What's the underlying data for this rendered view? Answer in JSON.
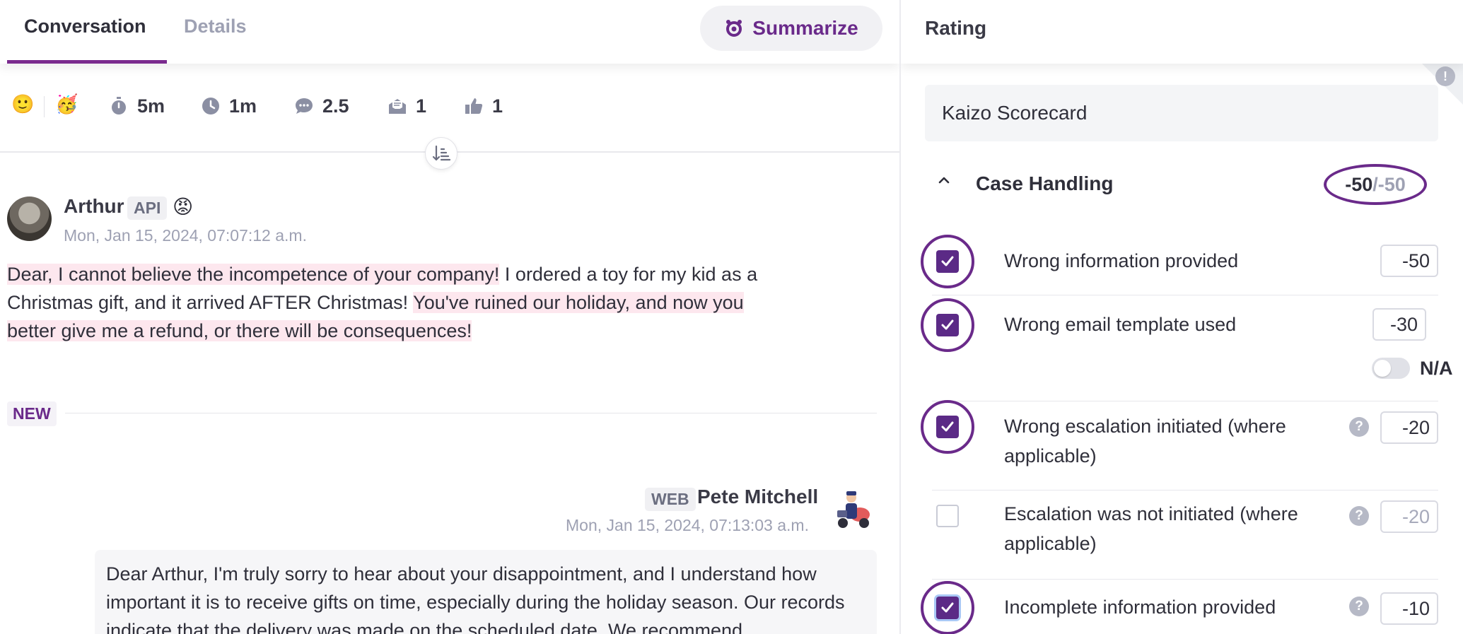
{
  "tabs": [
    {
      "label": "Conversation",
      "active": true
    },
    {
      "label": "Details",
      "active": false
    }
  ],
  "summarize": {
    "label": "Summarize"
  },
  "stats": {
    "emoji_face": "🙂",
    "emoji_party": "🥳",
    "handle_time": "5m",
    "response_time": "1m",
    "messages": "2.5",
    "emails": "1",
    "likes": "1"
  },
  "messages": [
    {
      "author": "Arthur",
      "channel": "API",
      "emoji": "😡",
      "timestamp": "Mon, Jan 15, 2024, 07:07:12 a.m.",
      "text_parts": [
        "Dear, I cannot believe the incompetence of your company!",
        " I ordered a toy for my kid as a Christmas gift, and it arrived AFTER Christmas! ",
        "You've ruined our holiday, and now you better give me a refund, or there will be consequences!"
      ]
    },
    {
      "author": "Pete Mitchell",
      "channel": "WEB",
      "timestamp": "Mon, Jan 15, 2024, 07:13:03 a.m.",
      "text": "Dear Arthur, I'm truly sorry to hear about your disappointment, and I understand how important it is to receive gifts on time, especially during the holiday season. Our records indicate that the delivery was made on the scheduled date. We recommend"
    }
  ],
  "new_label": "NEW",
  "rating": {
    "title": "Rating",
    "scorecard": "Kaizo Scorecard",
    "section": {
      "title": "Case Handling",
      "score": "-50",
      "max": "/-50"
    },
    "criteria": [
      {
        "label": "Wrong information provided",
        "checked": true,
        "score": "-50",
        "help": false
      },
      {
        "label": "Wrong email template used",
        "checked": true,
        "score": "-30",
        "help": false,
        "na_label": "N/A",
        "na_on": false
      },
      {
        "label": "Wrong escalation initiated (where applicable)",
        "checked": true,
        "score": "-20",
        "help": true
      },
      {
        "label": "Escalation was not initiated (where applicable)",
        "checked": false,
        "score": "-20",
        "help": true
      },
      {
        "label": "Incomplete information provided",
        "checked": true,
        "score": "-10",
        "help": true
      }
    ]
  },
  "colors": {
    "accent": "#6a2a8a",
    "highlight": "#fde7ee",
    "checkbox": "#5b2a86"
  }
}
